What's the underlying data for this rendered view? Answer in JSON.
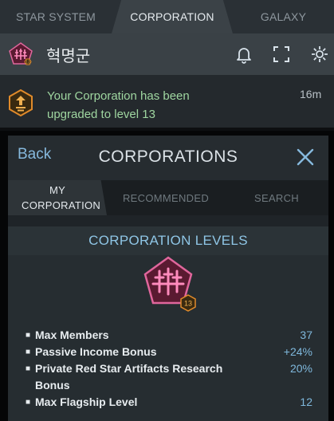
{
  "top_tabs": [
    "STAR SYSTEM",
    "CORPORATION",
    "GALAXY"
  ],
  "header": {
    "corp_name": "혁명군",
    "corp_level_badge": "13",
    "icons": [
      "bell-icon",
      "expand-icon",
      "gear-icon"
    ]
  },
  "notification": {
    "text": "Your Corporation has been upgraded to level 13",
    "time": "16m",
    "icon": "level-up-icon"
  },
  "dialog": {
    "back_label": "Back",
    "title": "CORPORATIONS",
    "close_icon": "close-icon",
    "tabs": [
      "MY CORPORATION",
      "RECOMMENDED",
      "SEARCH"
    ],
    "section_title": "CORPORATION LEVELS",
    "level": "13",
    "benefits": [
      {
        "label": "Max Members",
        "value": "37"
      },
      {
        "label": "Passive Income Bonus",
        "value": "+24%"
      },
      {
        "label": "Private Red Star Artifacts Research Bonus",
        "value": "20%"
      },
      {
        "label": "Max Flagship Level",
        "value": "12"
      }
    ]
  },
  "colors": {
    "accent_blue": "#86b9dd",
    "notification_green": "#9fd6a0",
    "emblem_pink": "#e0669c",
    "emblem_fill": "#5a1a31",
    "level_badge_orange": "#e08a2a"
  }
}
